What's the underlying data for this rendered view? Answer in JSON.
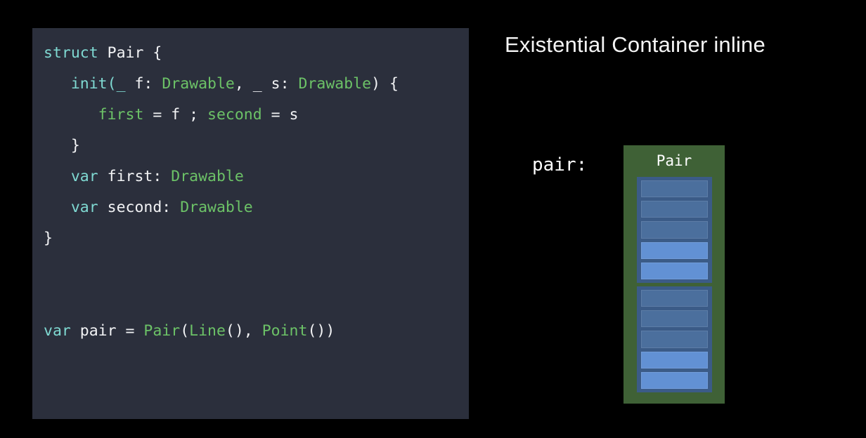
{
  "code": {
    "language": "swift",
    "lines": [
      {
        "id": "line-1",
        "tokens": [
          {
            "t": "struct",
            "c": "kw"
          },
          {
            "t": " ",
            "c": "pln"
          },
          {
            "t": "Pair",
            "c": "pln"
          },
          {
            "t": " {",
            "c": "pln"
          }
        ]
      },
      {
        "id": "line-2",
        "tokens": [
          {
            "t": "   ",
            "c": "pln"
          },
          {
            "t": "init",
            "c": "kw"
          },
          {
            "t": "(",
            "c": "pct"
          },
          {
            "t": "_",
            "c": "pct"
          },
          {
            "t": " f: ",
            "c": "pln"
          },
          {
            "t": "Drawable",
            "c": "typ"
          },
          {
            "t": ", ",
            "c": "pln"
          },
          {
            "t": "_",
            "c": "pln"
          },
          {
            "t": " s: ",
            "c": "pln"
          },
          {
            "t": "Drawable",
            "c": "typ"
          },
          {
            "t": ") {",
            "c": "pln"
          }
        ]
      },
      {
        "id": "line-3",
        "tokens": [
          {
            "t": "      ",
            "c": "pln"
          },
          {
            "t": "first",
            "c": "typ"
          },
          {
            "t": " = f ; ",
            "c": "pln"
          },
          {
            "t": "second",
            "c": "typ"
          },
          {
            "t": " = s",
            "c": "pln"
          }
        ]
      },
      {
        "id": "line-4",
        "tokens": [
          {
            "t": "   }",
            "c": "pln"
          }
        ]
      },
      {
        "id": "line-5",
        "tokens": [
          {
            "t": "   ",
            "c": "pln"
          },
          {
            "t": "var",
            "c": "kw"
          },
          {
            "t": " first: ",
            "c": "pln"
          },
          {
            "t": "Drawable",
            "c": "typ"
          }
        ]
      },
      {
        "id": "line-6",
        "tokens": [
          {
            "t": "   ",
            "c": "pln"
          },
          {
            "t": "var",
            "c": "kw"
          },
          {
            "t": " second: ",
            "c": "pln"
          },
          {
            "t": "Drawable",
            "c": "typ"
          }
        ]
      },
      {
        "id": "line-7",
        "tokens": [
          {
            "t": "}",
            "c": "pln"
          }
        ]
      },
      {
        "id": "line-8",
        "tokens": [
          {
            "t": " ",
            "c": "pln"
          }
        ]
      },
      {
        "id": "line-9",
        "tokens": [
          {
            "t": " ",
            "c": "pln"
          }
        ]
      },
      {
        "id": "line-10",
        "tokens": [
          {
            "t": "var",
            "c": "kw"
          },
          {
            "t": " pair = ",
            "c": "pln"
          },
          {
            "t": "Pair",
            "c": "typ"
          },
          {
            "t": "(",
            "c": "pln"
          },
          {
            "t": "Line",
            "c": "typ"
          },
          {
            "t": "(), ",
            "c": "pln"
          },
          {
            "t": "Point",
            "c": "typ"
          },
          {
            "t": "())",
            "c": "pln"
          }
        ]
      }
    ]
  },
  "diagram": {
    "title": "Existential Container inline",
    "variable_label": "pair:",
    "container_label": "Pair",
    "stacks": [
      {
        "id": "stack-first",
        "name": "first-existential-container",
        "cells": [
          {
            "kind": "value-buffer-word",
            "shade": "dark"
          },
          {
            "kind": "value-buffer-word",
            "shade": "dark"
          },
          {
            "kind": "value-buffer-word",
            "shade": "dark"
          },
          {
            "kind": "value-witness-table",
            "shade": "light"
          },
          {
            "kind": "protocol-witness-table",
            "shade": "light"
          }
        ]
      },
      {
        "id": "stack-second",
        "name": "second-existential-container",
        "cells": [
          {
            "kind": "value-buffer-word",
            "shade": "dark"
          },
          {
            "kind": "value-buffer-word",
            "shade": "dark"
          },
          {
            "kind": "value-buffer-word",
            "shade": "dark"
          },
          {
            "kind": "value-witness-table",
            "shade": "light"
          },
          {
            "kind": "protocol-witness-table",
            "shade": "light"
          }
        ]
      }
    ]
  },
  "colors": {
    "background": "#000000",
    "code_background": "#2b2f3c",
    "keyword": "#7fd9d2",
    "type": "#6cc267",
    "plain": "#f2f3f5",
    "container_green": "#3f6136",
    "stack_border_blue": "#3b5b87",
    "cell_dark_blue": "#4b6f9d",
    "cell_light_blue": "#6291d4",
    "title_text": "#f4f4f4"
  }
}
